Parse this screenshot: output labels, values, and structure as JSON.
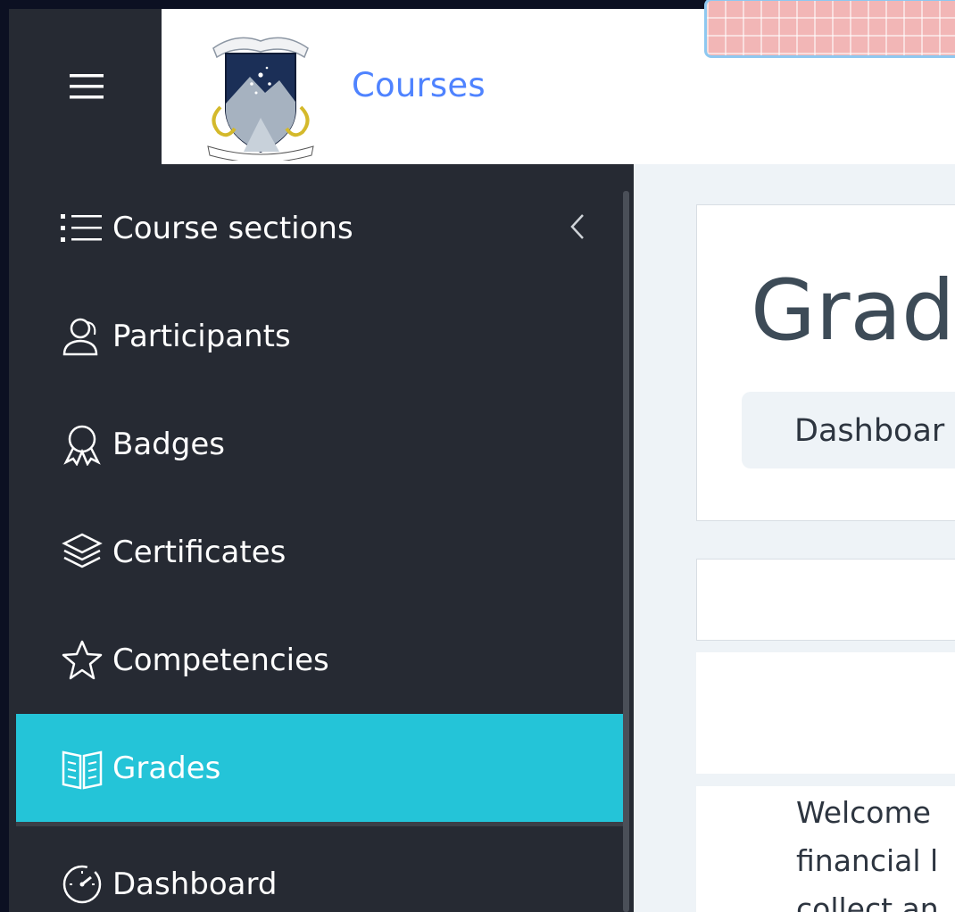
{
  "header": {
    "courses_link": "Courses"
  },
  "sidebar": {
    "items": [
      {
        "label": "Course sections",
        "icon": "list-icon"
      },
      {
        "label": "Participants",
        "icon": "users-icon"
      },
      {
        "label": "Badges",
        "icon": "badge-icon"
      },
      {
        "label": "Certificates",
        "icon": "layers-icon"
      },
      {
        "label": "Competencies",
        "icon": "star-icon"
      },
      {
        "label": "Grades",
        "icon": "book-icon",
        "active": true
      },
      {
        "label": "Dashboard",
        "icon": "gauge-icon"
      }
    ]
  },
  "main": {
    "page_title": "Grad",
    "breadcrumb": "Dashboar",
    "intro_lines": [
      "Welcome",
      "financial l",
      "collect an"
    ]
  },
  "colors": {
    "sidebar_bg": "#262a33",
    "active_item": "#24c4d8",
    "link": "#4f83ff",
    "main_bg": "#eef3f7"
  }
}
